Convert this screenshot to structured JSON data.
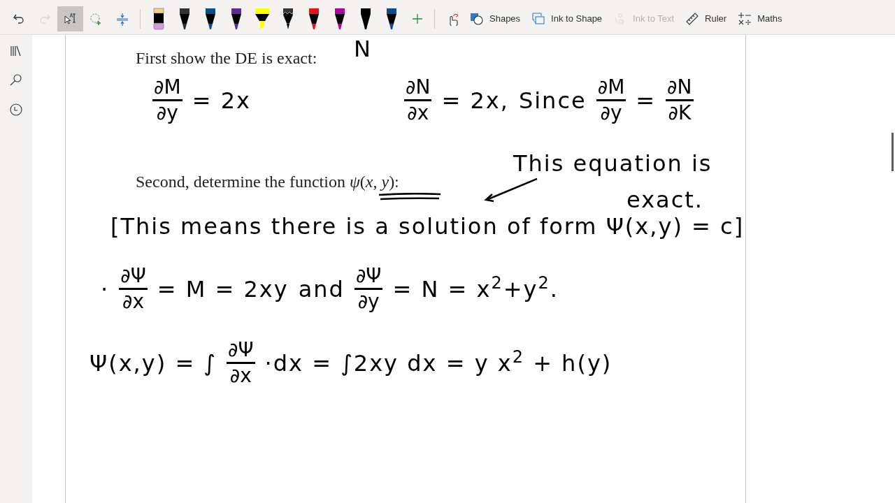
{
  "toolbar": {
    "tools": [
      {
        "kind": "undo",
        "selected": false,
        "disabled": false
      },
      {
        "kind": "redo",
        "selected": false,
        "disabled": true
      },
      {
        "kind": "type-select",
        "selected": true,
        "disabled": false
      },
      {
        "kind": "lasso",
        "selected": false,
        "disabled": false
      },
      {
        "kind": "add-space",
        "selected": false,
        "disabled": false
      }
    ],
    "pens": [
      {
        "kind": "eraser",
        "color": "#f5d08a"
      },
      {
        "kind": "pen",
        "color": "#333333"
      },
      {
        "kind": "pen",
        "color": "#0f4c8a"
      },
      {
        "kind": "pen",
        "color": "#5c2d91"
      },
      {
        "kind": "highlighter",
        "color": "#ffff00"
      },
      {
        "kind": "pencil",
        "color": "#333333"
      },
      {
        "kind": "pen",
        "color": "#e81123"
      },
      {
        "kind": "pen",
        "color": "#b4009e"
      },
      {
        "kind": "pen",
        "color": "#000000"
      },
      {
        "kind": "pen",
        "color": "#0f4c8a"
      }
    ],
    "buttons": [
      {
        "kind": "touch",
        "disabled": false
      },
      {
        "kind": "shapes",
        "label": "Shapes",
        "disabled": false
      },
      {
        "kind": "ink-to-shape",
        "label": "Ink to Shape",
        "disabled": false
      },
      {
        "kind": "ink-to-text",
        "label": "Ink to Text",
        "disabled": true
      },
      {
        "kind": "ruler",
        "label": "Ruler",
        "disabled": false
      },
      {
        "kind": "maths",
        "label": "Maths",
        "disabled": false
      }
    ]
  },
  "page": {
    "items": [
      {
        "kind": "ink",
        "parts": [
          {
            "kind": "text",
            "text": "N"
          }
        ]
      },
      {
        "kind": "typed",
        "text": "First show the DE is exact:"
      },
      {
        "kind": "ink",
        "parts": [
          {
            "kind": "frac",
            "num": "∂M",
            "den": "∂y"
          },
          {
            "kind": "text",
            "text": "= 2x"
          }
        ]
      },
      {
        "kind": "ink",
        "parts": [
          {
            "kind": "frac",
            "num": "∂N",
            "den": "∂x"
          },
          {
            "kind": "text",
            "text": "= 2x,"
          },
          {
            "kind": "text",
            "text": "Since"
          },
          {
            "kind": "frac",
            "num": "∂M",
            "den": "∂y"
          },
          {
            "kind": "text",
            "text": "="
          },
          {
            "kind": "frac",
            "num": "∂N",
            "den": "∂K"
          }
        ]
      },
      {
        "kind": "typed",
        "text": "Second, determine the function *ψ*(*x*, *y*):"
      },
      {
        "kind": "ink",
        "parts": [
          {
            "kind": "text",
            "text": "This equation is"
          }
        ]
      },
      {
        "kind": "ink",
        "parts": [
          {
            "kind": "text",
            "text": "exact."
          }
        ]
      },
      {
        "kind": "ink",
        "parts": [
          {
            "kind": "text",
            "text": "[This means there is a solution of form Ψ(x,y) = c]"
          }
        ]
      },
      {
        "kind": "ink",
        "parts": [
          {
            "kind": "text",
            "text": "·"
          },
          {
            "kind": "frac",
            "num": "∂Ψ",
            "den": "∂x"
          },
          {
            "kind": "text",
            "text": "= M = 2xy"
          },
          {
            "kind": "text",
            "text": "and"
          },
          {
            "kind": "frac",
            "num": "∂Ψ",
            "den": "∂y"
          },
          {
            "kind": "text",
            "text": "= N = x$^{2}$+y$^{2}$."
          }
        ]
      },
      {
        "kind": "ink",
        "parts": [
          {
            "kind": "text",
            "text": "Ψ(x,y) = ∫"
          },
          {
            "kind": "frac",
            "num": "∂Ψ",
            "den": "∂x"
          },
          {
            "kind": "text",
            "text": "·dx = ∫2xy dx = y x$^{2}$ + h(y)"
          }
        ]
      }
    ]
  }
}
